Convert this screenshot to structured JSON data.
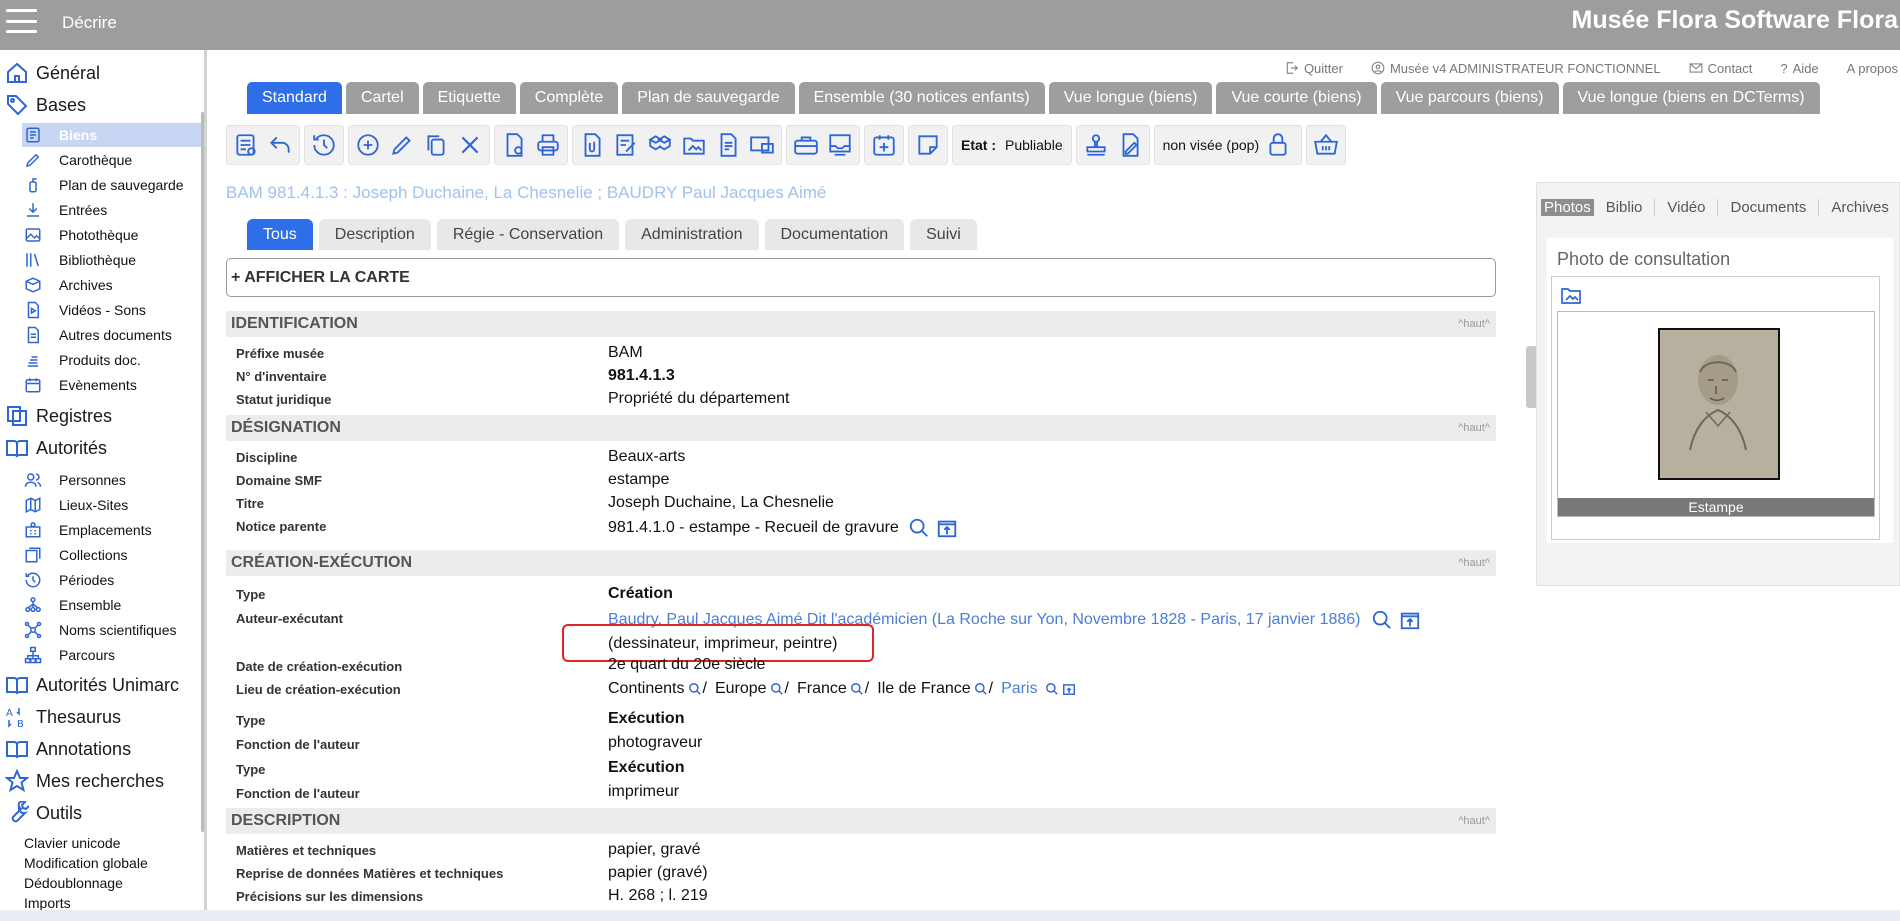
{
  "topbar": {
    "menu_title": "Décrire",
    "brand": "Musée Flora Software Flora"
  },
  "header_links": {
    "quit": "Quitter",
    "user": "Musée v4 ADMINISTRATEUR FONCTIONNEL",
    "contact": "Contact",
    "help": "Aide",
    "about": "A propos"
  },
  "sidebar": {
    "general": "Général",
    "bases": "Bases",
    "bases_items": [
      "Biens",
      "Carothèque",
      "Plan de sauvegarde",
      "Entrées",
      "Photothèque",
      "Bibliothèque",
      "Archives",
      "Vidéos - Sons",
      "Autres documents",
      "Produits doc.",
      "Evènements"
    ],
    "registres": "Registres",
    "autorites": "Autorités",
    "autorites_items": [
      "Personnes",
      "Lieux-Sites",
      "Emplacements",
      "Collections",
      "Périodes",
      "Ensemble",
      "Noms scientifiques",
      "Parcours"
    ],
    "autorites_unimarc": "Autorités Unimarc",
    "thesaurus": "Thesaurus",
    "annotations": "Annotations",
    "mes_recherches": "Mes recherches",
    "outils": "Outils",
    "outils_items": [
      "Clavier unicode",
      "Modification globale",
      "Dédoublonnage",
      "Imports"
    ]
  },
  "view_tabs": [
    "Standard",
    "Cartel",
    "Etiquette",
    "Complète",
    "Plan de sauvegarde",
    "Ensemble (30 notices enfants)",
    "Vue longue (biens)",
    "Vue courte (biens)",
    "Vue parcours (biens)",
    "Vue longue (biens en DCTerms)"
  ],
  "toolbar": {
    "etat_label": "Etat :",
    "etat_value": "Publiable",
    "visee": "non visée (pop)"
  },
  "notice_title": "BAM 981.4.1.3 : Joseph Duchaine, La Chesnelie ; BAUDRY Paul Jacques Aimé",
  "sub_tabs": [
    "Tous",
    "Description",
    "Régie - Conservation",
    "Administration",
    "Documentation",
    "Suivi"
  ],
  "map_toggle": "+ AFFICHER LA CARTE",
  "haut": "^haut^",
  "sections": {
    "identification": "IDENTIFICATION",
    "designation": "DÉSIGNATION",
    "creation": "CRÉATION-EXÉCUTION",
    "description": "DESCRIPTION"
  },
  "fields": {
    "prefixe_label": "Préfixe musée",
    "prefixe_value": "BAM",
    "inventaire_label": "N° d'inventaire",
    "inventaire_value": "981.4.1.3",
    "statut_label": "Statut juridique",
    "statut_value": "Propriété du département",
    "discipline_label": "Discipline",
    "discipline_value": "Beaux-arts",
    "domaine_label": "Domaine SMF",
    "domaine_value": "estampe",
    "titre_label": "Titre",
    "titre_value": "Joseph Duchaine, La Chesnelie",
    "parente_label": "Notice parente",
    "parente_value": "981.4.1.0 - estampe - Recueil de gravure",
    "type1_label": "Type",
    "type1_value": "Création",
    "auteur_label": "Auteur-exécutant",
    "auteur_value": "Baudry, Paul Jacques Aimé Dit l'académicien (La Roche sur Yon, Novembre 1828 - Paris, 17 janvier 1886)",
    "auteur_roles": "(dessinateur, imprimeur, peintre)",
    "date_label": "Date de création-exécution",
    "date_value": "2e quart du 20e siècle",
    "lieu_label": "Lieu de création-exécution",
    "lieu_values": [
      "Continents",
      "Europe",
      "France",
      "Ile de France",
      "Paris"
    ],
    "type2_label": "Type",
    "type2_value": "Exécution",
    "fonction1_label": "Fonction de l'auteur",
    "fonction1_value": "photograveur",
    "type3_label": "Type",
    "type3_value": "Exécution",
    "fonction2_label": "Fonction de l'auteur",
    "fonction2_value": "imprimeur",
    "matieres_label": "Matières et techniques",
    "matieres_value": "papier, gravé",
    "reprise_label": "Reprise de données Matières et techniques",
    "reprise_value": "papier (gravé)",
    "dimensions_label": "Précisions sur les dimensions",
    "dimensions_value": "H. 268 ; l. 219"
  },
  "right_panel": {
    "tabs": [
      "Photos",
      "Biblio",
      "Vidéo",
      "Documents",
      "Archives"
    ],
    "photo_heading": "Photo de consultation",
    "caption": "Estampe"
  },
  "colors": {
    "accent": "#2e6fe8",
    "topbar": "#9d9d9d",
    "icon": "#2f66d6",
    "highlight": "#e02424"
  }
}
